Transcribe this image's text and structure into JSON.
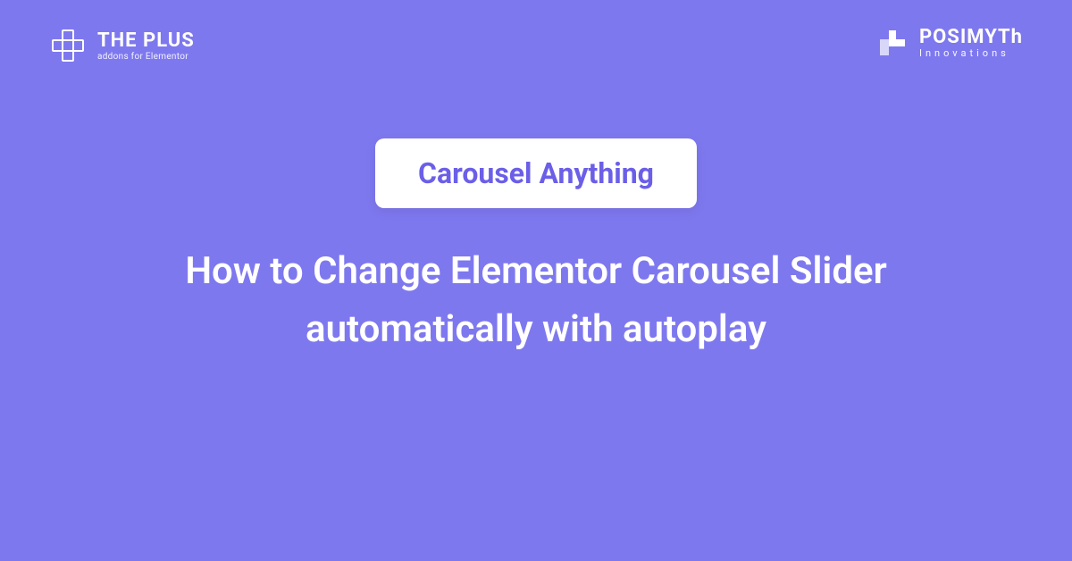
{
  "header": {
    "brand_left": {
      "title": "THE PLUS",
      "subtitle": "addons for Elementor"
    },
    "brand_right": {
      "title": "POSIMYTh",
      "subtitle": "Innovations"
    }
  },
  "content": {
    "badge_label": "Carousel Anything",
    "main_title": "How to Change Elementor Carousel Slider automatically with autoplay"
  }
}
